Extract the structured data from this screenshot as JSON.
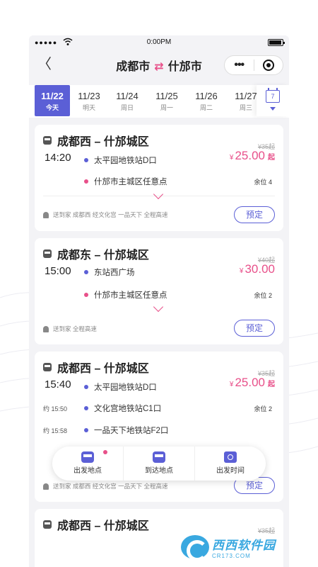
{
  "status_bar": {
    "signal": "●●●●●",
    "time": "0:00PM"
  },
  "nav": {
    "from_city": "成都市",
    "to_city": "什邡市",
    "swap_glyph": "⇄",
    "back_glyph": "〈",
    "more_glyph": "•••"
  },
  "dates": [
    {
      "date": "11/22",
      "weekday": "今天",
      "active": true
    },
    {
      "date": "11/23",
      "weekday": "明天"
    },
    {
      "date": "11/24",
      "weekday": "周日"
    },
    {
      "date": "11/25",
      "weekday": "周一"
    },
    {
      "date": "11/26",
      "weekday": "周二"
    },
    {
      "date": "11/27",
      "weekday": "周三"
    }
  ],
  "calendar_icon_text": "7",
  "cards": [
    {
      "route": "成都西 – 什邡城区",
      "time": "14:20",
      "orig_price": "¥35起",
      "currency": "¥",
      "price": "25.00",
      "price_suffix": "起",
      "stops": [
        "太平园地铁站D口",
        "什邡市主城区任意点"
      ],
      "seats": "余位 4",
      "tags": "送到家 成都西 经文化宫 一品天下 全程高速",
      "book": "预定"
    },
    {
      "route": "成都东 – 什邡城区",
      "time": "15:00",
      "orig_price": "¥40起",
      "currency": "¥",
      "price": "30.00",
      "stops": [
        "东站西广场",
        "什邡市主城区任意点"
      ],
      "seats": "余位 2",
      "tags": "送到家 全程高速",
      "book": "预定"
    },
    {
      "route": "成都西 – 什邡城区",
      "time": "15:40",
      "orig_price": "¥35起",
      "currency": "¥",
      "price": "25.00",
      "price_suffix": "起",
      "stops": [
        "太平园地铁站D口",
        "文化宫地铁站C1口",
        "一品天下地铁站F2口"
      ],
      "stop_times": [
        "约 15:50",
        "约 15:58"
      ],
      "seats": "余位 2",
      "tags": "送到家 成都西 经文化宫 一品天下 全程高速",
      "book": "预定"
    },
    {
      "route": "成都西 – 什邡城区",
      "orig_price": "¥35起"
    }
  ],
  "filter_bar": [
    "出发地点",
    "到达地点",
    "出发时间"
  ],
  "watermark": {
    "main": "西西软件园",
    "sub": "CR173.COM"
  },
  "colors": {
    "accent": "#5b5fd6",
    "price": "#e8508a"
  }
}
